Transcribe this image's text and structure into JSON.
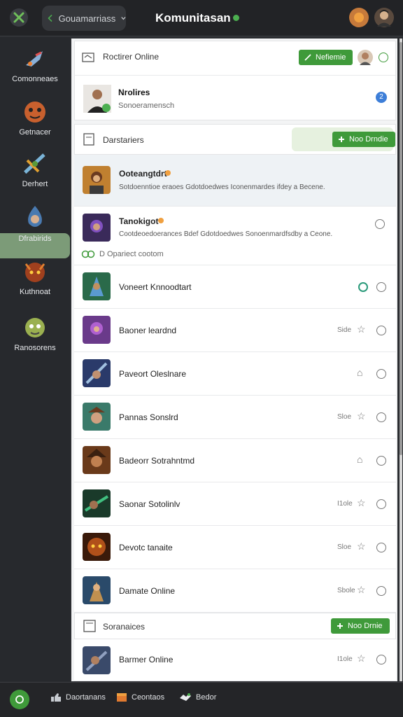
{
  "topbar": {
    "back_label": "Gouamarriass",
    "title": "Komunitasan",
    "logo": "x-logo-icon",
    "status_color": "#4caf50"
  },
  "sidebar": {
    "items": [
      {
        "label": "Comonneaes",
        "icon": "spaceship-icon"
      },
      {
        "label": "Getnacer",
        "icon": "mask-icon"
      },
      {
        "label": "Derhert",
        "icon": "weapon-icon"
      },
      {
        "label": "Dfrabirids",
        "icon": "droplet-hero-icon",
        "active": true
      },
      {
        "label": "Kuthnoat",
        "icon": "demon-icon"
      },
      {
        "label": "Ranosorens",
        "icon": "goblin-icon"
      }
    ]
  },
  "sections": {
    "online": {
      "title": "Roctirer Online",
      "button": "Nefiemie",
      "profile_name": "Nrolires",
      "profile_sub": "Sonoeramensch",
      "badge": "2"
    },
    "darstarters": {
      "title": "Darstariers",
      "button": "Noo Drndie"
    },
    "featured": [
      {
        "name": "Ooteangtdrt",
        "desc": "Sotdoenntioe eraoes Gdotdoedwes Iconenmardes ifdey a Becene."
      },
      {
        "name": "Tanokigot",
        "desc": "Cootdeoedoerances Bdef Gdotdoedwes Sonoenmardfsdby a Ceone."
      }
    ],
    "divider_text": "D Opariect cootom",
    "list": [
      {
        "name": "Voneert Knnoodtart",
        "meta": ""
      },
      {
        "name": "Baoner leardnd",
        "meta": "Side"
      },
      {
        "name": "Paveort Oleslnare",
        "meta": ""
      },
      {
        "name": "Pannas Sonslrd",
        "meta": "Sloe"
      },
      {
        "name": "Badeorr Sotrahntmd",
        "meta": ""
      },
      {
        "name": "Saonar Sotolinlv",
        "meta": "I1ole"
      },
      {
        "name": "Devotc tanaite",
        "meta": "Sloe"
      },
      {
        "name": "Damate Online",
        "meta": "Sbole"
      }
    ],
    "sonranices": {
      "title": "Soranaices",
      "button": "Noo Drnie",
      "item": {
        "name": "Barmer Online",
        "meta": "I1ole"
      }
    }
  },
  "bottombar": {
    "items": [
      {
        "label": "Daortanans",
        "icon": "thumbs-icon"
      },
      {
        "label": "Ceontaos",
        "icon": "chest-icon"
      },
      {
        "label": "Bedor",
        "icon": "handshake-icon"
      }
    ]
  }
}
